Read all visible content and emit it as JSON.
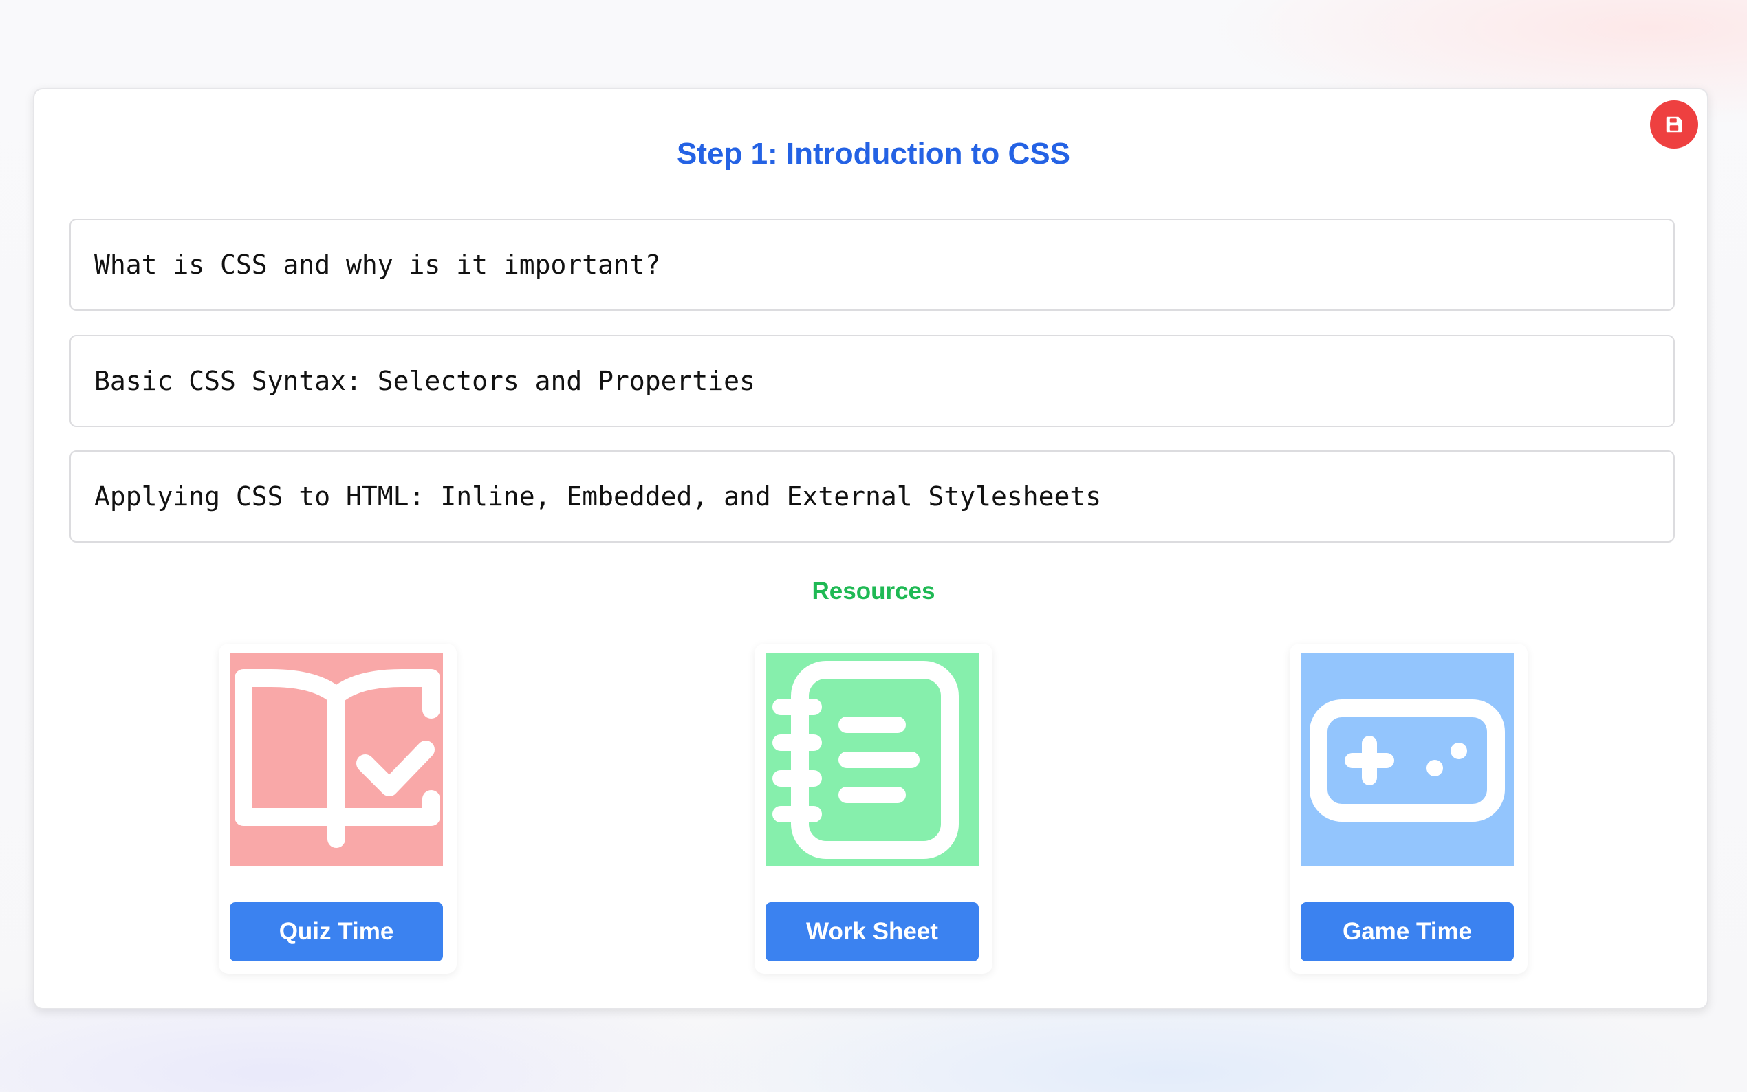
{
  "lesson": {
    "title": "Step 1: Introduction to CSS",
    "topics": [
      "What is CSS and why is it important?",
      "Basic CSS Syntax: Selectors and Properties",
      "Applying CSS to HTML: Inline, Embedded, and External Stylesheets"
    ]
  },
  "resources": {
    "heading": "Resources",
    "items": [
      {
        "label": "Quiz Time",
        "icon": "book-check-icon",
        "color": "#f9a8a8"
      },
      {
        "label": "Work Sheet",
        "icon": "notebook-list-icon",
        "color": "#86efac"
      },
      {
        "label": "Game Time",
        "icon": "gamepad-icon",
        "color": "#93c5fd"
      }
    ]
  },
  "close_button": {
    "icon": "save-icon",
    "color": "#ee4040"
  },
  "colors": {
    "title": "#2462e4",
    "resources_heading": "#1fb954",
    "button": "#3b82f0"
  }
}
